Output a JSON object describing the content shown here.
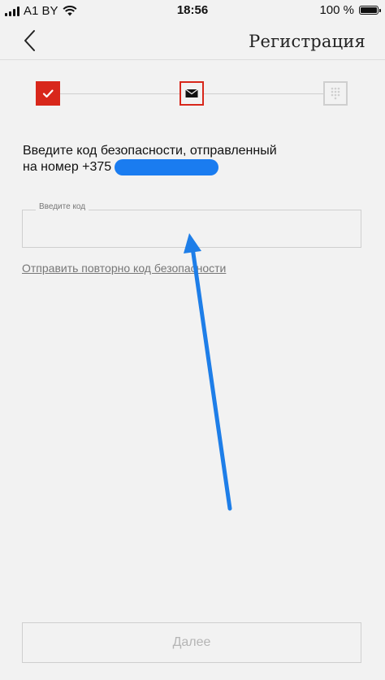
{
  "status_bar": {
    "carrier": "A1 BY",
    "time": "18:56",
    "battery": "100 %",
    "battery_level": 1.0,
    "icons": [
      "signal-icon",
      "wifi-icon",
      "battery-icon"
    ]
  },
  "nav": {
    "title": "Регистрация",
    "back_icon": "chevron-left-icon"
  },
  "stepper": {
    "steps": [
      {
        "icon": "check-icon",
        "state": "completed"
      },
      {
        "icon": "envelope-icon",
        "state": "active"
      },
      {
        "icon": "keypad-icon",
        "state": "inactive"
      }
    ]
  },
  "form": {
    "instruction_line1": "Введите код безопасности, отправленный",
    "instruction_line2": "на номер +375",
    "code_label": "Введите код",
    "code_value": "",
    "resend_link": "Отправить повторно код безопасности",
    "next_button": "Далее"
  },
  "annotation": {
    "icon": "arrow-icon"
  },
  "colors": {
    "accent": "#d8271b",
    "background": "#f2f2f2",
    "border": "#cfcfcf",
    "mask": "#1a7cf0",
    "arrow": "#1e7ee8"
  }
}
